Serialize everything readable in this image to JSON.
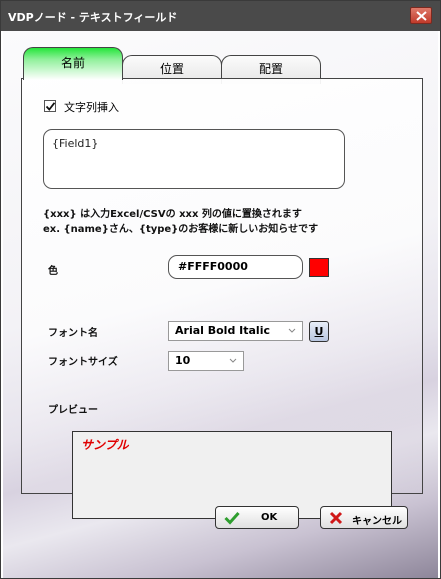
{
  "window": {
    "title": "VDPノード - テキストフィールド"
  },
  "tabs": [
    {
      "label": "名前",
      "active": true
    },
    {
      "label": "位置",
      "active": false
    },
    {
      "label": "配置",
      "active": false
    }
  ],
  "insert_checkbox": {
    "label": "文字列挿入",
    "checked": true
  },
  "text_field": {
    "value": "{Field1}"
  },
  "help": {
    "line1": "{xxx} は入力Excel/CSVの xxx 列の値に置換されます",
    "line2": "ex. {name}さん、{type}のお客様に新しいお知らせです"
  },
  "color": {
    "label": "色",
    "value": "#FFFF0000",
    "swatch": "#ff0000"
  },
  "font_name": {
    "label": "フォント名",
    "value": "Arial Bold Italic",
    "underline_label": "U"
  },
  "font_size": {
    "label": "フォントサイズ",
    "value": "10"
  },
  "preview": {
    "label": "プレビュー",
    "sample": "サンプル",
    "sample_color": "#e00000"
  },
  "buttons": {
    "ok": "OK",
    "cancel": "キャンセル"
  },
  "colors": {
    "active_tab": "#2ee844",
    "titlebar": "#4a4a4a",
    "close": "#c8483a"
  }
}
